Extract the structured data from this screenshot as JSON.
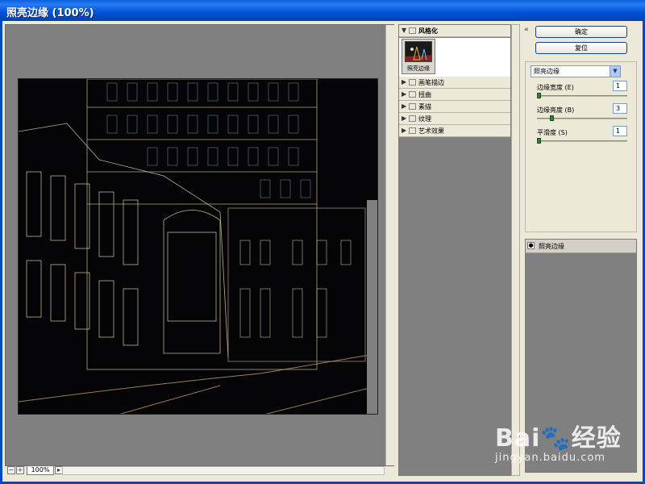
{
  "window": {
    "title": "照亮边缘 (100%)"
  },
  "preview": {
    "zoom": "100%",
    "zoom_out_icon": "minus-icon",
    "zoom_in_icon": "plus-icon",
    "zoom_menu_icon": "chevron-right-icon"
  },
  "gallery": {
    "folders": [
      {
        "label": "风格化",
        "open": true
      },
      {
        "label": "画笔描边",
        "open": false
      },
      {
        "label": "扭曲",
        "open": false
      },
      {
        "label": "素描",
        "open": false
      },
      {
        "label": "纹理",
        "open": false
      },
      {
        "label": "艺术效果",
        "open": false
      }
    ],
    "thumbnails": [
      {
        "label": "照亮边缘",
        "selected": true
      }
    ]
  },
  "panel": {
    "ok_label": "确定",
    "reset_label": "复位",
    "filter_select": "照亮边缘",
    "params": [
      {
        "label": "边缘宽度 (E)",
        "value": "1",
        "level": 0.0
      },
      {
        "label": "边缘亮度 (B)",
        "value": "3",
        "level": 0.15
      },
      {
        "label": "平滑度 (S)",
        "value": "1",
        "level": 0.0
      }
    ],
    "layer_label": "照亮边缘"
  },
  "watermark": {
    "logo": "Bai🐾经验",
    "url": "jingyan.baidu.com"
  },
  "colors": {
    "accent": "#0052d6",
    "preview_bg": "#808080",
    "panel_bg": "#ece9d8"
  }
}
